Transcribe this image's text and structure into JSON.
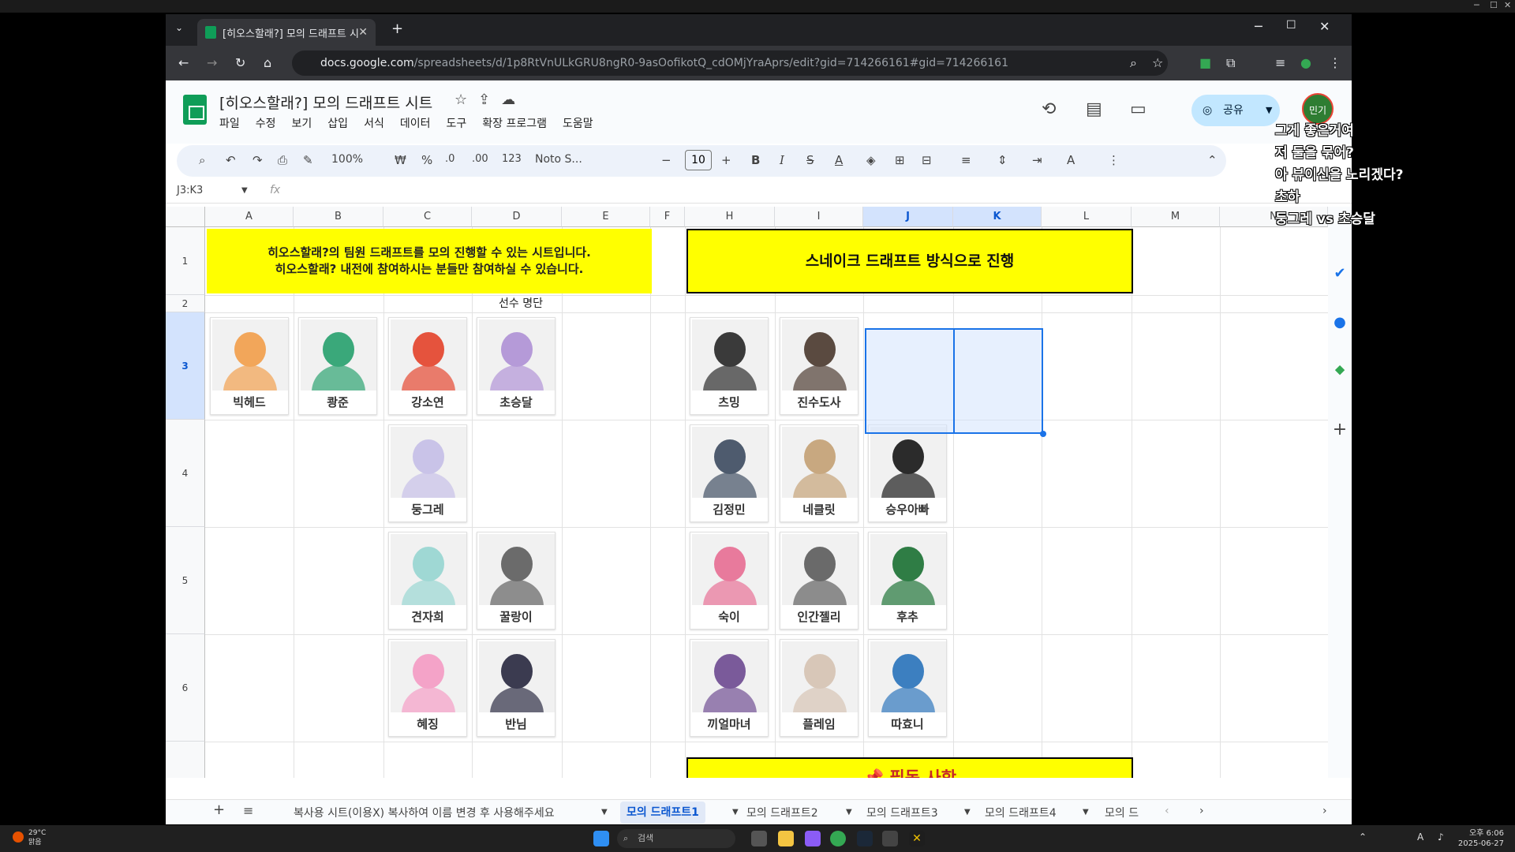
{
  "browser": {
    "tab_title": "[히오스할래?] 모의 드래프트 시",
    "url_host": "docs.google.com",
    "url_path": "/spreadsheets/d/1p8RtVnULkGRU8ngR0-9asOofikotQ_cdOMjYraAprs/edit?gid=714266161#gid=714266161"
  },
  "sheets": {
    "doc_title": "[히오스할래?] 모의 드래프트 시트",
    "menus": [
      "파일",
      "수정",
      "보기",
      "삽입",
      "서식",
      "데이터",
      "도구",
      "확장 프로그램",
      "도움말"
    ],
    "share_label": "공유",
    "avatar_label": "민기",
    "zoom": "100%",
    "currency": "₩",
    "percent": "%",
    "dec_less": ".0",
    "dec_more": ".00",
    "number_format": "123",
    "font_name": "Noto S...",
    "font_size": "10",
    "name_box": "J3:K3",
    "fx": "fx"
  },
  "columns": [
    {
      "label": "A"
    },
    {
      "label": "B"
    },
    {
      "label": "C"
    },
    {
      "label": "D"
    },
    {
      "label": "E"
    },
    {
      "label": "F"
    },
    {
      "label": "H"
    },
    {
      "label": "I"
    },
    {
      "label": "J"
    },
    {
      "label": "K"
    },
    {
      "label": "L"
    },
    {
      "label": "M"
    },
    {
      "label": "N"
    }
  ],
  "rows": [
    {
      "label": "1"
    },
    {
      "label": "2"
    },
    {
      "label": "3"
    },
    {
      "label": "4"
    },
    {
      "label": "5"
    },
    {
      "label": "6"
    }
  ],
  "banner_left": {
    "line1": "히오스할래?의 팀원 드래프트를 모의 진행할 수 있는 시트입니다.",
    "line2": "히오스할래? 내전에 참여하시는 분들만 참여하실 수 있습니다."
  },
  "banner_right": "스네이크 드래프트 방식으로 진행",
  "roster_title": "선수 명단",
  "notice_banner": "📌 필독 사항",
  "roster": [
    {
      "name": "빅헤드",
      "color": "#f2a65a"
    },
    {
      "name": "쾅준",
      "color": "#3aa87a"
    },
    {
      "name": "강소연",
      "color": "#e5533d"
    },
    {
      "name": "초승달",
      "color": "#b59ad8"
    },
    {
      "name": "둥그레",
      "color": "#c9c3e8"
    },
    {
      "name": "견자희",
      "color": "#9fd8d4"
    },
    {
      "name": "꿀랑이",
      "color": "#6b6b6b"
    },
    {
      "name": "혜징",
      "color": "#f4a3c8"
    },
    {
      "name": "반님",
      "color": "#3b3b50"
    }
  ],
  "draft": [
    {
      "name": "츠밍",
      "color": "#3a3a3a"
    },
    {
      "name": "진수도사",
      "color": "#5a4a40"
    },
    {
      "name": "김정민",
      "color": "#4e5b6e"
    },
    {
      "name": "네클릿",
      "color": "#c8a880"
    },
    {
      "name": "승우아빠",
      "color": "#2b2b2b"
    },
    {
      "name": "숙이",
      "color": "#e87a9c"
    },
    {
      "name": "인간젤리",
      "color": "#6a6a6a"
    },
    {
      "name": "후추",
      "color": "#2f7d45"
    },
    {
      "name": "끼얼마녀",
      "color": "#7a5a9a"
    },
    {
      "name": "플레임",
      "color": "#d8c7b8"
    },
    {
      "name": "따효니",
      "color": "#3c7fc0"
    }
  ],
  "sheet_tabs": [
    {
      "label": "복사용 시트(이용X) 복사하여 이름 변경 후 사용해주세요"
    },
    {
      "label": "모의 드래프트1"
    },
    {
      "label": "모의 드래프트2"
    },
    {
      "label": "모의 드래프트3"
    },
    {
      "label": "모의 드래프트4"
    },
    {
      "label": "모의 드"
    }
  ],
  "chat": [
    "그게 좋은거여",
    "저 둘을 묶어?",
    "아 뷰이신을 노리겠다?",
    "초하",
    "둥그레 vs 초승달"
  ],
  "taskbar": {
    "temp": "29°C",
    "weather": "맑음",
    "search": "검색",
    "time": "오후 6:06",
    "date": "2025-06-27"
  }
}
